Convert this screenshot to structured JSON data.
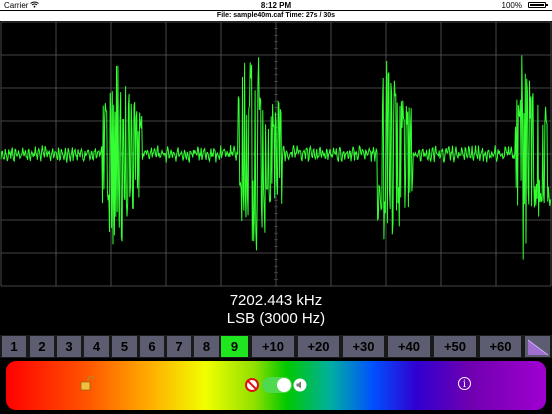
{
  "status": {
    "carrier": "Carrier",
    "time": "8:12 PM",
    "battery": "100%"
  },
  "file_info": "File: sample40m.caf  Time: 27s /  30s",
  "scope": {
    "trace_color": "#33ff33",
    "grid_color": "#5a5a5a"
  },
  "readout": {
    "frequency": "7202.443 kHz",
    "mode": "LSB (3000 Hz)"
  },
  "buttons": [
    "1",
    "2",
    "3",
    "4",
    "5",
    "6",
    "7",
    "8",
    "9",
    "+10",
    "+20",
    "+30",
    "+40",
    "+50",
    "+60"
  ],
  "active_button": "9",
  "colors": {
    "active": "#1fe61f",
    "button": "#5c5d70"
  },
  "controls": {
    "lock_icon": "open-lock-icon",
    "mute_icon": "no-entry-icon",
    "toggle_on": true,
    "speaker_icon": "speaker-icon",
    "info_icon": "info-icon",
    "info_glyph": "i"
  }
}
